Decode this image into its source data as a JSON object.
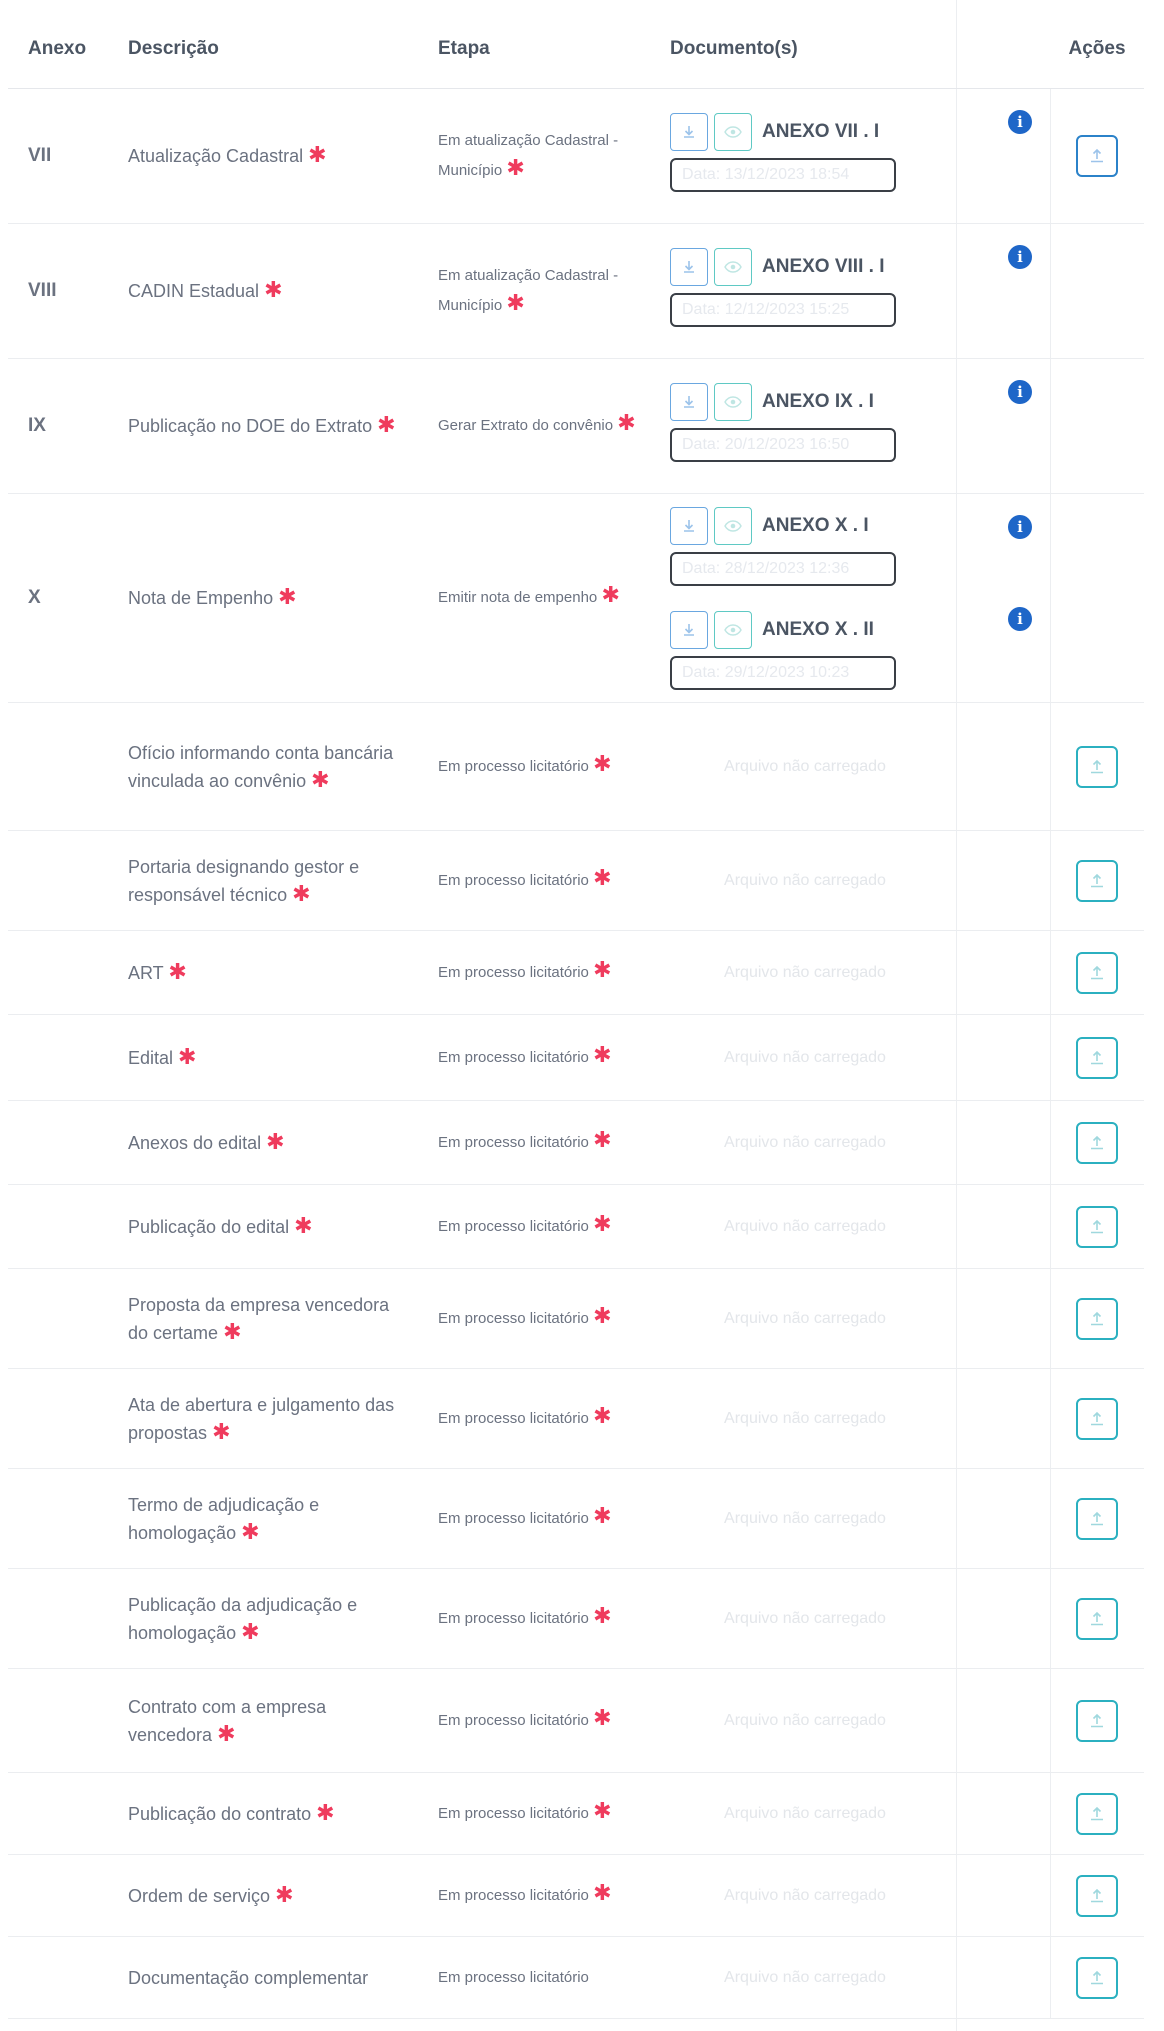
{
  "headers": {
    "anexo": "Anexo",
    "descricao": "Descrição",
    "etapa": "Etapa",
    "documentos": "Documento(s)",
    "acoes": "Ações"
  },
  "star": "✱",
  "empty_doc_text": "Arquivo não carregado",
  "rows_with_docs": [
    {
      "anexo": "VII",
      "descricao": "Atualização Cadastral",
      "etapa": "Em atualização Cadastral - Município",
      "docs": [
        {
          "name": "ANEXO VII . I",
          "date": "Data: 13/12/2023 18:54"
        }
      ],
      "has_upload": true
    },
    {
      "anexo": "VIII",
      "descricao": "CADIN Estadual",
      "etapa": "Em atualização Cadastral - Município",
      "docs": [
        {
          "name": "ANEXO VIII . I",
          "date": "Data: 12/12/2023 15:25"
        }
      ],
      "has_upload": false
    },
    {
      "anexo": "IX",
      "descricao": "Publicação no DOE do Extrato",
      "etapa": "Gerar Extrato do convênio",
      "docs": [
        {
          "name": "ANEXO IX . I",
          "date": "Data: 20/12/2023 16:50"
        }
      ],
      "has_upload": false
    },
    {
      "anexo": "X",
      "descricao": "Nota de Empenho",
      "etapa": "Emitir nota de empenho",
      "docs": [
        {
          "name": "ANEXO X . I",
          "date": "Data: 28/12/2023 12:36"
        },
        {
          "name": "ANEXO X . II",
          "date": "Data: 29/12/2023 10:23"
        }
      ],
      "has_upload": false
    }
  ],
  "rows_pending": [
    {
      "descricao": "Ofício informando conta bancária vinculada ao convênio",
      "etapa": "Em processo licitatório",
      "required": true
    },
    {
      "descricao": "Portaria designando gestor e responsável técnico",
      "etapa": "Em processo licitatório",
      "required": true
    },
    {
      "descricao": "ART",
      "etapa": "Em processo licitatório",
      "required": true
    },
    {
      "descricao": "Edital",
      "etapa": "Em processo licitatório",
      "required": true
    },
    {
      "descricao": "Anexos do edital",
      "etapa": "Em processo licitatório",
      "required": true
    },
    {
      "descricao": "Publicação do edital",
      "etapa": "Em processo licitatório",
      "required": true
    },
    {
      "descricao": "Proposta da empresa vencedora do certame",
      "etapa": "Em processo licitatório",
      "required": true
    },
    {
      "descricao": "Ata de abertura e julgamento das propostas",
      "etapa": "Em processo licitatório",
      "required": true
    },
    {
      "descricao": "Termo de adjudicação e homologação",
      "etapa": "Em processo licitatório",
      "required": true
    },
    {
      "descricao": "Publicação da adjudicação e homologação",
      "etapa": "Em processo licitatório",
      "required": true
    },
    {
      "descricao": "Contrato com a empresa vencedora",
      "etapa": "Em processo licitatório",
      "required": true
    },
    {
      "descricao": "Publicação do contrato",
      "etapa": "Em processo licitatório",
      "required": true
    },
    {
      "descricao": "Ordem de serviço",
      "etapa": "Em processo licitatório",
      "required": true
    },
    {
      "descricao": "Documentação complementar",
      "etapa": "Em processo licitatório",
      "required": false
    }
  ],
  "colors": {
    "accent_blue": "#1e66c8",
    "accent_teal": "#2bb0c0",
    "required_star": "#ef3b5d"
  }
}
